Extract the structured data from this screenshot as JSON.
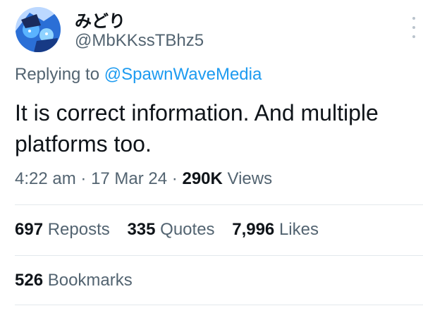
{
  "author": {
    "display_name": "みどり",
    "handle": "@MbKKssTBhz5",
    "avatar_icon": "avatar-illustration"
  },
  "reply_context": {
    "prefix": "Replying to",
    "mention": "@SpawnWaveMedia"
  },
  "tweet": {
    "text": "It is correct information. And multiple platforms too."
  },
  "meta": {
    "time": "4:22 am",
    "sep1": "·",
    "date": "17 Mar 24",
    "sep2": "·",
    "views_count": "290K",
    "views_label": "Views"
  },
  "stats": {
    "reposts": {
      "count": "697",
      "label": "Reposts"
    },
    "quotes": {
      "count": "335",
      "label": "Quotes"
    },
    "likes": {
      "count": "7,996",
      "label": "Likes"
    },
    "bookmarks": {
      "count": "526",
      "label": "Bookmarks"
    }
  },
  "colors": {
    "link": "#1d9bf0",
    "secondary_text": "#536471",
    "primary_text": "#0f1419"
  }
}
